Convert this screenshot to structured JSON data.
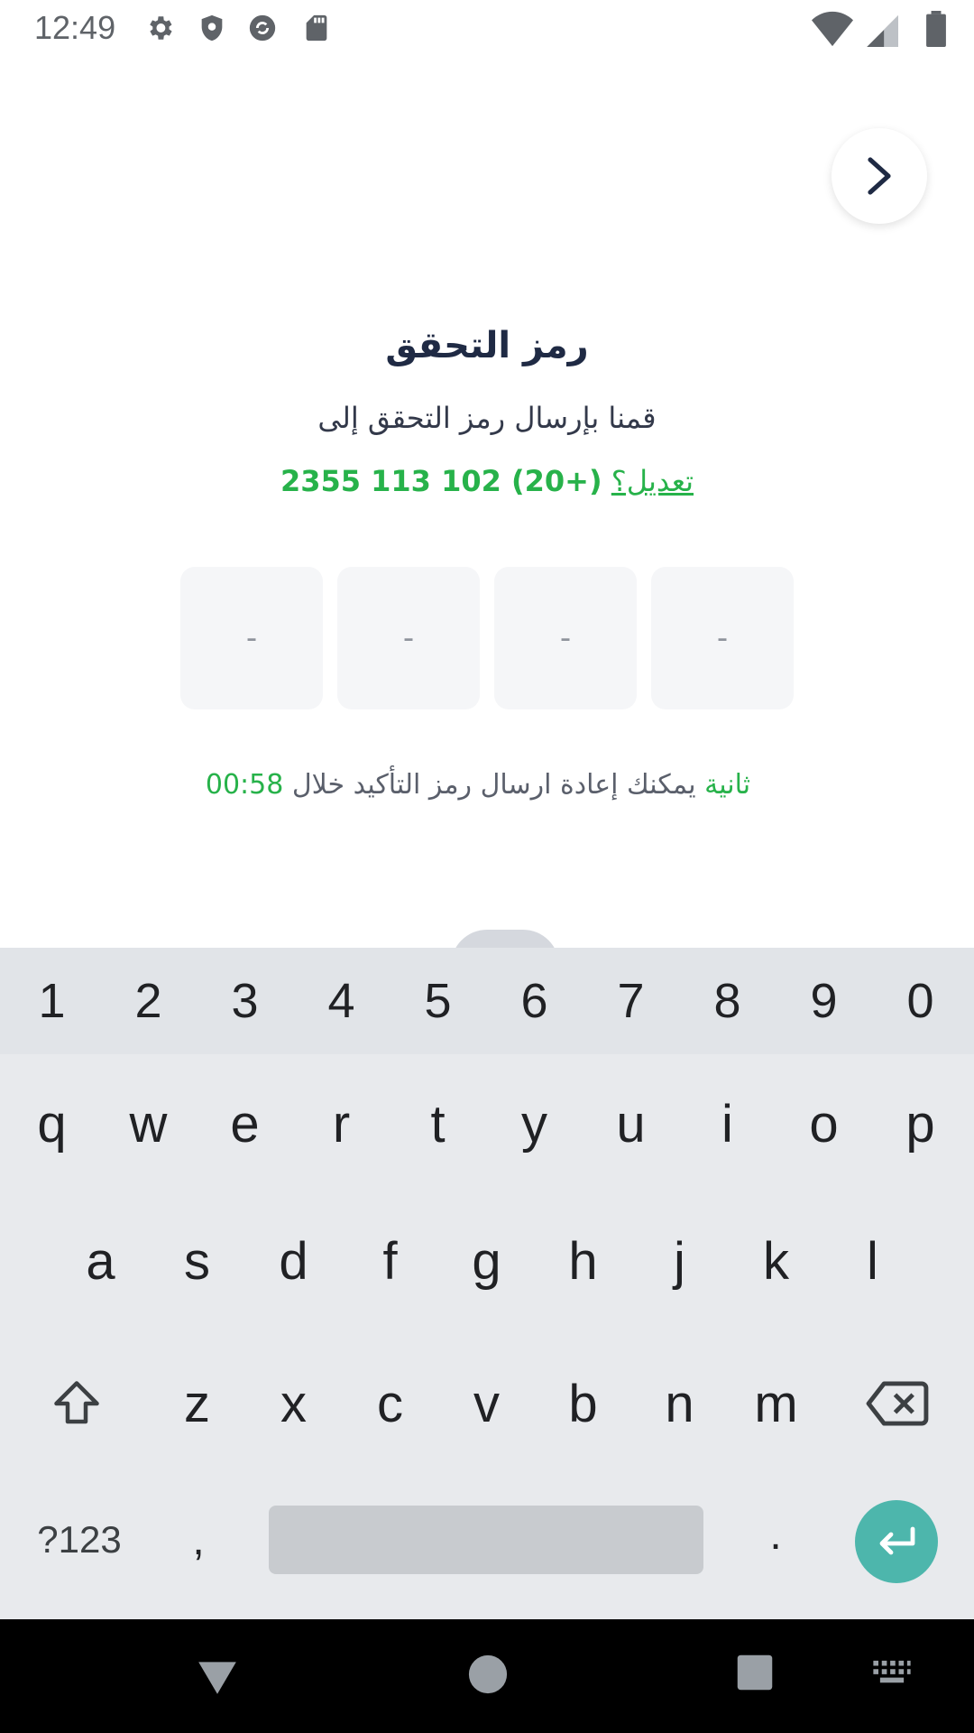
{
  "status_bar": {
    "time": "12:49",
    "icons": [
      "settings-icon",
      "shield-icon",
      "sync-icon",
      "sd-card-icon",
      "wifi-icon",
      "signal-icon",
      "battery-icon"
    ]
  },
  "header": {
    "back_icon": "chevron-right-icon"
  },
  "verification": {
    "title": "رمز التحقق",
    "subtitle": "قمنا بإرسال رمز التحقق إلى",
    "phone": "(+20) 102 113 2355",
    "edit_label": "تعديل؟",
    "otp_placeholders": [
      "-",
      "-",
      "-",
      "-"
    ],
    "resend_text": "يمكنك إعادة ارسال رمز التأكيد خلال",
    "resend_timer": "00:58 ثانية"
  },
  "keyboard": {
    "numbers": [
      "1",
      "2",
      "3",
      "4",
      "5",
      "6",
      "7",
      "8",
      "9",
      "0"
    ],
    "row1": [
      "q",
      "w",
      "e",
      "r",
      "t",
      "y",
      "u",
      "i",
      "o",
      "p"
    ],
    "row2": [
      "a",
      "s",
      "d",
      "f",
      "g",
      "h",
      "j",
      "k",
      "l"
    ],
    "row3": [
      "z",
      "x",
      "c",
      "v",
      "b",
      "n",
      "m"
    ],
    "symbols_label": "?123",
    "comma": ",",
    "period": ".",
    "accent_color": "#4db6ac"
  },
  "colors": {
    "brand_green": "#27b24a",
    "title": "#1f2a44"
  }
}
